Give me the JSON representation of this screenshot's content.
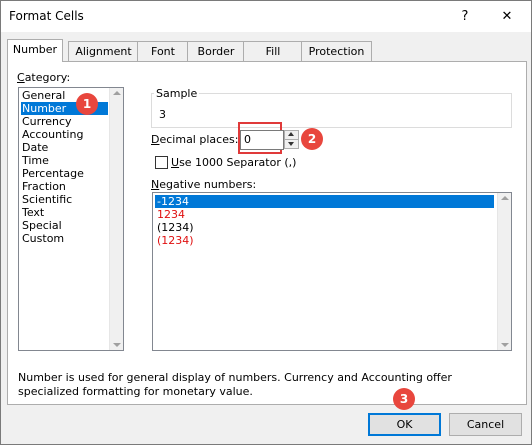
{
  "window": {
    "title": "Format Cells",
    "help_glyph": "?",
    "close_glyph": "✕"
  },
  "tabs": [
    {
      "label": "Number",
      "active": true
    },
    {
      "label": "Alignment"
    },
    {
      "label": "Font"
    },
    {
      "label": "Border"
    },
    {
      "label": "Fill"
    },
    {
      "label": "Protection"
    }
  ],
  "category": {
    "label_first": "C",
    "label_rest": "ategory:",
    "items": [
      "General",
      "Number",
      "Currency",
      "Accounting",
      "Date",
      "Time",
      "Percentage",
      "Fraction",
      "Scientific",
      "Text",
      "Special",
      "Custom"
    ],
    "selected": "Number"
  },
  "sample": {
    "label": "Sample",
    "value": "3"
  },
  "decimal": {
    "label_first": "D",
    "label_rest": "ecimal places:",
    "value": "0"
  },
  "separator": {
    "label_first": "U",
    "label_rest": "se 1000 Separator (,)",
    "checked": false
  },
  "negative": {
    "label_first": "N",
    "label_rest": "egative numbers:",
    "items": [
      "-1234",
      "1234",
      "(1234)",
      "(1234)"
    ],
    "selected": "-1234",
    "red_color": "#e01010"
  },
  "description": "Number is used for general display of numbers.  Currency and Accounting offer specialized formatting for monetary value.",
  "buttons": {
    "ok": "OK",
    "cancel": "Cancel"
  },
  "annotations": {
    "badge1": "1",
    "badge2": "2",
    "badge3": "3",
    "badge_color": "#e8463d"
  }
}
